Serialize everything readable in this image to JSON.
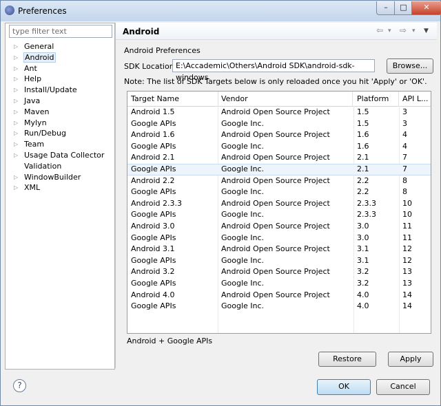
{
  "window": {
    "title": "Preferences",
    "min": "–",
    "max": "□",
    "close": "✕"
  },
  "filter": {
    "placeholder": "type filter text"
  },
  "tree": [
    {
      "label": "General",
      "arrow": "▷"
    },
    {
      "label": "Android",
      "arrow": "▷",
      "selected": true
    },
    {
      "label": "Ant",
      "arrow": "▷"
    },
    {
      "label": "Help",
      "arrow": "▷"
    },
    {
      "label": "Install/Update",
      "arrow": "▷"
    },
    {
      "label": "Java",
      "arrow": "▷"
    },
    {
      "label": "Maven",
      "arrow": "▷"
    },
    {
      "label": "Mylyn",
      "arrow": "▷"
    },
    {
      "label": "Run/Debug",
      "arrow": "▷"
    },
    {
      "label": "Team",
      "arrow": "▷"
    },
    {
      "label": "Usage Data Collector",
      "arrow": "▷"
    },
    {
      "label": "Validation",
      "arrow": ""
    },
    {
      "label": "WindowBuilder",
      "arrow": "▷"
    },
    {
      "label": "XML",
      "arrow": "▷"
    }
  ],
  "page": {
    "title": "Android",
    "nav_back": "⇦",
    "nav_back_menu": "▾",
    "nav_forward": "⇨",
    "nav_forward_menu": "▾",
    "view_menu": "▼",
    "subtitle": "Android Preferences",
    "sdk_label": "SDK Location:",
    "sdk_value": "E:\\Accademic\\Others\\Android SDK\\android-sdk-windows",
    "browse": "Browse...",
    "note": "Note: The list of SDK Targets below is only reloaded once you hit 'Apply' or 'OK'.",
    "footer_text": "Android + Google APIs",
    "restore_defaults": "Restore Defaults",
    "apply": "Apply"
  },
  "table": {
    "headers": [
      "Target Name",
      "Vendor",
      "Platform",
      "API L..."
    ],
    "rows": [
      [
        "Android 1.5",
        "Android Open Source Project",
        "1.5",
        "3"
      ],
      [
        "Google APIs",
        "Google Inc.",
        "1.5",
        "3"
      ],
      [
        "Android 1.6",
        "Android Open Source Project",
        "1.6",
        "4"
      ],
      [
        "Google APIs",
        "Google Inc.",
        "1.6",
        "4"
      ],
      [
        "Android 2.1",
        "Android Open Source Project",
        "2.1",
        "7"
      ],
      [
        "Google APIs",
        "Google Inc.",
        "2.1",
        "7"
      ],
      [
        "Android 2.2",
        "Android Open Source Project",
        "2.2",
        "8"
      ],
      [
        "Google APIs",
        "Google Inc.",
        "2.2",
        "8"
      ],
      [
        "Android 2.3.3",
        "Android Open Source Project",
        "2.3.3",
        "10"
      ],
      [
        "Google APIs",
        "Google Inc.",
        "2.3.3",
        "10"
      ],
      [
        "Android 3.0",
        "Android Open Source Project",
        "3.0",
        "11"
      ],
      [
        "Google APIs",
        "Google Inc.",
        "3.0",
        "11"
      ],
      [
        "Android 3.1",
        "Android Open Source Project",
        "3.1",
        "12"
      ],
      [
        "Google APIs",
        "Google Inc.",
        "3.1",
        "12"
      ],
      [
        "Android 3.2",
        "Android Open Source Project",
        "3.2",
        "13"
      ],
      [
        "Google APIs",
        "Google Inc.",
        "3.2",
        "13"
      ],
      [
        "Android 4.0",
        "Android Open Source Project",
        "4.0",
        "14"
      ],
      [
        "Google APIs",
        "Google Inc.",
        "4.0",
        "14"
      ]
    ],
    "selected_row": 5
  },
  "buttons": {
    "help": "?",
    "ok": "OK",
    "cancel": "Cancel"
  }
}
